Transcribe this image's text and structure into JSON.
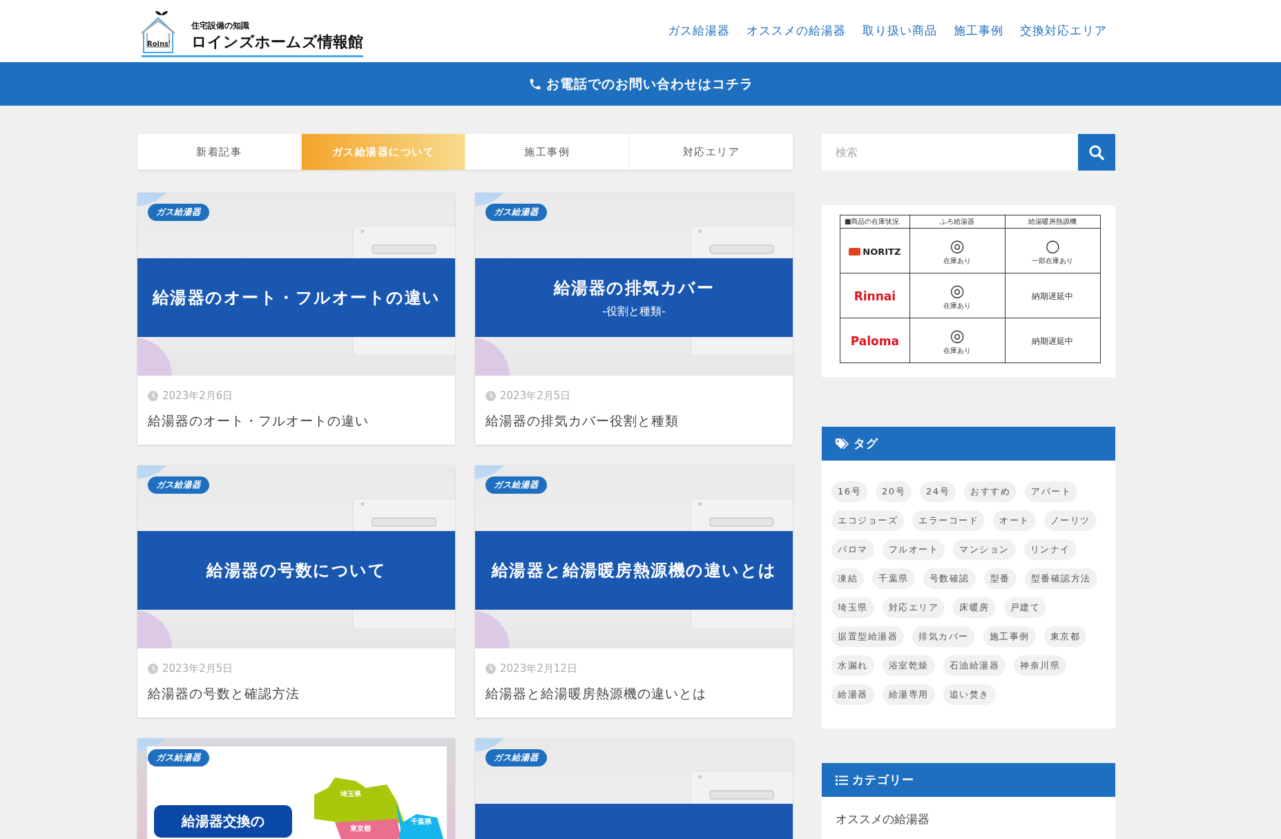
{
  "header": {
    "logo": {
      "mark": "Roins'",
      "tagline": "住宅設備の知識",
      "name": "ロインズホームズ情報館"
    },
    "nav": [
      {
        "label": "ガス給湯器"
      },
      {
        "label": "オススメの給湯器"
      },
      {
        "label": "取り扱い商品"
      },
      {
        "label": "施工事例"
      },
      {
        "label": "交換対応エリア"
      }
    ]
  },
  "call_bar": {
    "label": "お電話でのお問い合わせはコチラ"
  },
  "tabs": [
    {
      "label": "新着記事",
      "selected": false
    },
    {
      "label": "ガス給湯器について",
      "selected": true
    },
    {
      "label": "施工事例",
      "selected": false
    },
    {
      "label": "対応エリア",
      "selected": false
    }
  ],
  "posts": [
    {
      "kind": "banner",
      "category": "ガス給湯器",
      "banner_title": "給湯器のオート・フルオートの違い",
      "date": "2023年2月6日",
      "title": "給湯器のオート・フルオートの違い"
    },
    {
      "kind": "banner",
      "category": "ガス給湯器",
      "banner_title": "給湯器の排気カバー",
      "banner_subtitle": "-役割と種類-",
      "date": "2023年2月5日",
      "title": "給湯器の排気カバー役割と種類"
    },
    {
      "kind": "banner",
      "category": "ガス給湯器",
      "banner_title": "給湯器の号数について",
      "date": "2023年2月5日",
      "title": "給湯器の号数と確認方法"
    },
    {
      "kind": "banner",
      "category": "ガス給湯器",
      "banner_title": "給湯器と給湯暖房熱源機の違いとは",
      "date": "2023年2月12日",
      "title": "給湯器と給湯暖房熱源機の違いとは"
    },
    {
      "kind": "map",
      "category": "ガス給湯器",
      "banner_title": "給湯器交換の",
      "map_labels": [
        "埼玉県",
        "東京都",
        "千葉県"
      ]
    },
    {
      "kind": "banner",
      "category": "ガス給湯器"
    }
  ],
  "search": {
    "placeholder": "検索"
  },
  "stock_table": {
    "columns": [
      "■商品の在庫状況",
      "ふろ給湯器",
      "給湯暖房熱源機"
    ],
    "rows": [
      {
        "cells": [
          {
            "kind": "brand",
            "text": "NORITZ",
            "color": "#222222"
          },
          {
            "kind": "stock",
            "mark": "◎",
            "note": "在庫あり"
          },
          {
            "kind": "stock",
            "mark": "○",
            "note": "一部在庫あり"
          }
        ]
      },
      {
        "cells": [
          {
            "kind": "brand",
            "text": "Rinnai",
            "color": "#e0141e"
          },
          {
            "kind": "stock",
            "mark": "◎",
            "note": "在庫あり"
          },
          {
            "kind": "status",
            "text": "納期遅延中"
          }
        ]
      },
      {
        "cells": [
          {
            "kind": "brand",
            "text": "Paloma",
            "color": "#e0141e"
          },
          {
            "kind": "stock",
            "mark": "◎",
            "note": "在庫あり"
          },
          {
            "kind": "status",
            "text": "納期遅延中"
          }
        ]
      }
    ]
  },
  "tags": {
    "title": "タグ",
    "items": [
      "16号",
      "20号",
      "24号",
      "おすすめ",
      "アパート",
      "エコジョーズ",
      "エラーコード",
      "オート",
      "ノーリツ",
      "パロマ",
      "フルオート",
      "マンション",
      "リンナイ",
      "凍結",
      "千葉県",
      "号数確認",
      "型番",
      "型番確認方法",
      "埼玉県",
      "対応エリア",
      "床暖房",
      "戸建て",
      "据置型給湯器",
      "排気カバー",
      "施工事例",
      "東京都",
      "水漏れ",
      "浴室乾燥",
      "石油給湯器",
      "神奈川県",
      "給湯器",
      "給湯専用",
      "追い焚き"
    ]
  },
  "categories": {
    "title": "カテゴリー",
    "items": [
      "オススメの給湯器"
    ]
  }
}
